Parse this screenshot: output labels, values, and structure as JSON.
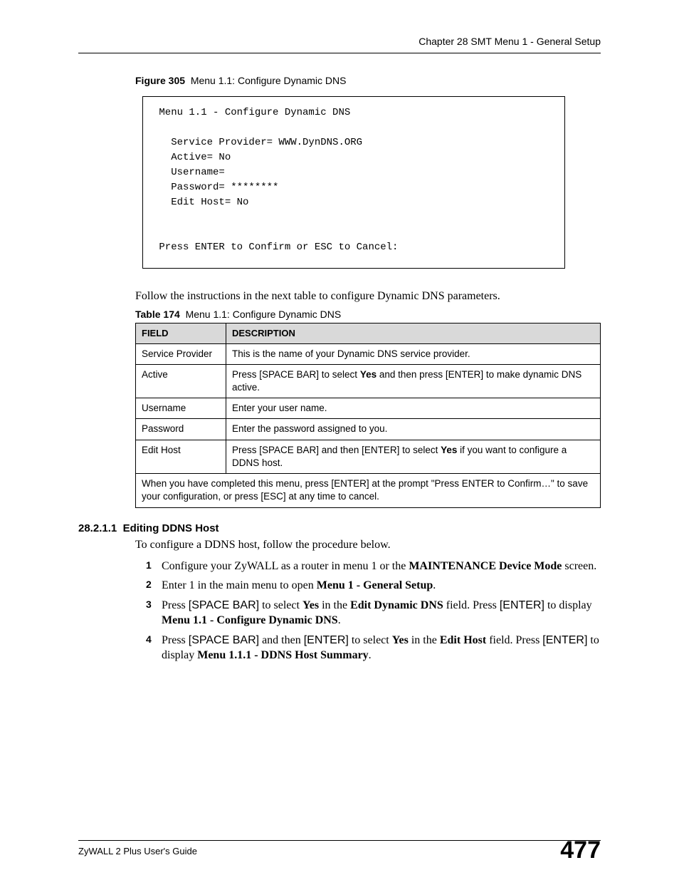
{
  "header": {
    "chapter": "Chapter 28 SMT Menu 1 - General Setup"
  },
  "figure": {
    "label": "Figure 305",
    "caption": "Menu 1.1: Configure Dynamic DNS",
    "terminal": " Menu 1.1 - Configure Dynamic DNS\n\n   Service Provider= WWW.DynDNS.ORG\n   Active= No\n   Username=\n   Password= ********\n   Edit Host= No\n\n\n Press ENTER to Confirm or ESC to Cancel:"
  },
  "intro_text": "Follow the instructions in the next table to configure Dynamic DNS parameters.",
  "table": {
    "label": "Table 174",
    "caption": "Menu 1.1: Configure Dynamic DNS",
    "head_field": "FIELD",
    "head_desc": "DESCRIPTION",
    "rows": [
      {
        "field": "Service Provider",
        "desc_pre": "This is the name of your Dynamic DNS service provider.",
        "bold": "",
        "desc_post": ""
      },
      {
        "field": "Active",
        "desc_pre": "Press [SPACE BAR] to select ",
        "bold": "Yes",
        "desc_post": " and then press [ENTER] to make dynamic DNS active."
      },
      {
        "field": "Username",
        "desc_pre": "Enter your user name.",
        "bold": "",
        "desc_post": ""
      },
      {
        "field": "Password",
        "desc_pre": "Enter the password assigned to you.",
        "bold": "",
        "desc_post": ""
      },
      {
        "field": "Edit Host",
        "desc_pre": "Press [SPACE BAR] and then [ENTER] to select ",
        "bold": "Yes",
        "desc_post": " if you want to configure a DDNS host."
      }
    ],
    "footer": "When you have completed this menu, press [ENTER] at the prompt \"Press ENTER to Confirm…\" to save your configuration, or press [ESC] at any time to cancel."
  },
  "section": {
    "number": "28.2.1.1",
    "title": "Editing DDNS Host",
    "intro": "To configure a DDNS host, follow the procedure below."
  },
  "steps": {
    "s1_a": "Configure your ZyWALL as a router in menu 1 or the ",
    "s1_b": "MAINTENANCE Device Mode",
    "s1_c": " screen.",
    "s2_a": "Enter 1 in the main menu to open ",
    "s2_b": "Menu 1 - General Setup",
    "s2_c": ".",
    "s3_a": "Press ",
    "s3_b": "[SPACE BAR]",
    "s3_c": " to select ",
    "s3_d": "Yes",
    "s3_e": " in the ",
    "s3_f": "Edit Dynamic DNS",
    "s3_g": " field. Press ",
    "s3_h": "[ENTER]",
    "s3_i": " to display ",
    "s3_j": "Menu 1.1 - Configure Dynamic DNS",
    "s3_k": ".",
    "s4_a": "Press ",
    "s4_b": "[SPACE BAR]",
    "s4_c": " and then ",
    "s4_d": "[ENTER]",
    "s4_e": " to select ",
    "s4_f": "Yes",
    "s4_g": " in the ",
    "s4_h": "Edit Host",
    "s4_i": " field. Press ",
    "s4_j": "[ENTER]",
    "s4_k": " to display ",
    "s4_l": "Menu 1.1.1 - DDNS Host Summary",
    "s4_m": "."
  },
  "footer": {
    "guide": "ZyWALL 2 Plus User's Guide",
    "page": "477"
  }
}
